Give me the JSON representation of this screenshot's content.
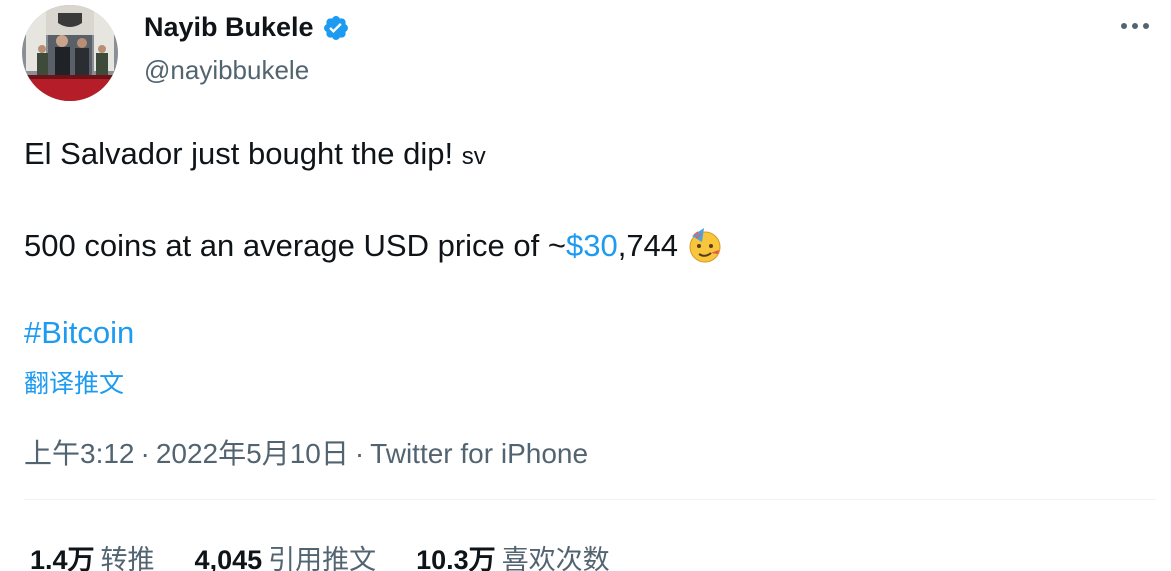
{
  "author": {
    "display_name": "Nayib Bukele",
    "handle": "@nayibbukele"
  },
  "tweet": {
    "line1_text": "El Salvador just bought the dip! ",
    "line1_flag": "sv",
    "line2_prefix": "500 coins at an average USD price of ~",
    "line2_cashtag": "$30",
    "line2_suffix": ",744",
    "hashtag": "#Bitcoin"
  },
  "translate_label": "翻译推文",
  "meta": {
    "time": "上午3:12",
    "separator": "·",
    "date": "2022年5月10日",
    "source": "Twitter for iPhone"
  },
  "stats": {
    "retweets_count": "1.4万",
    "retweets_label": "转推",
    "quotes_count": "4,045",
    "quotes_label": "引用推文",
    "likes_count": "10.3万",
    "likes_label": "喜欢次数"
  },
  "colors": {
    "link": "#1d9bf0",
    "text": "#0f1419",
    "secondary": "#536471",
    "verified": "#1d9bf0"
  },
  "icons": {
    "verified": "verified-badge-icon",
    "more": "more-options-icon",
    "emoji": "face-with-party-hat-icon"
  }
}
